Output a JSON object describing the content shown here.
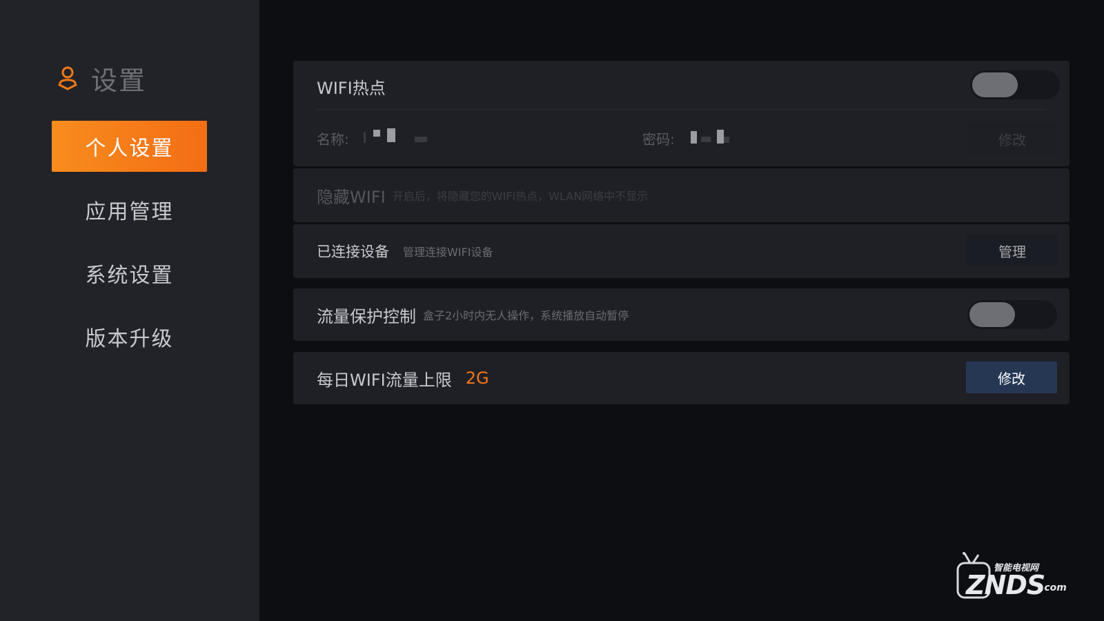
{
  "sidebar": {
    "title": "设置",
    "items": [
      {
        "label": "个人设置",
        "active": true
      },
      {
        "label": "应用管理",
        "active": false
      },
      {
        "label": "系统设置",
        "active": false
      },
      {
        "label": "版本升级",
        "active": false
      }
    ]
  },
  "panels": {
    "hotspot": {
      "title": "WIFI热点",
      "toggle_state": "off",
      "name_label": "名称:",
      "password_label": "密码:",
      "edit_label": "修改"
    },
    "hide_wifi": {
      "title": "隐藏WIFI",
      "description": "开启后，将隐藏您的WIFI热点，WLAN网络中不显示"
    },
    "connected_devices": {
      "title": "已连接设备",
      "description": "管理连接WIFI设备",
      "manage_label": "管理"
    },
    "traffic_protection": {
      "title": "流量保护控制",
      "description": "盒子2小时内无人操作，系统播放自动暂停",
      "toggle_state": "off"
    },
    "daily_limit": {
      "title": "每日WIFI流量上限",
      "value": "2G",
      "edit_label": "修改"
    }
  },
  "watermark": {
    "brand": "ZNDS",
    "domain_suffix": ".com",
    "tagline": "智能电视网"
  },
  "colors": {
    "accent": "#f57a17",
    "sidebar_bg": "#222328",
    "main_bg": "#0d0e12",
    "panel_bg": "#1f2025",
    "primary_button": "#263754",
    "value_highlight": "#f4761a"
  }
}
